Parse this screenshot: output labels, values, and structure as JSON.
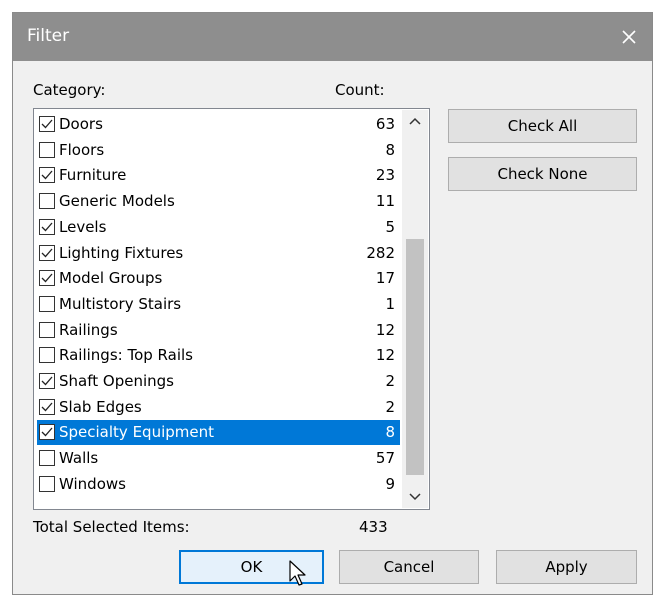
{
  "window": {
    "title": "Filter"
  },
  "headers": {
    "category": "Category:",
    "count": "Count:"
  },
  "items": [
    {
      "name": "Doors",
      "count": "63",
      "checked": true
    },
    {
      "name": "Floors",
      "count": "8",
      "checked": false
    },
    {
      "name": "Furniture",
      "count": "23",
      "checked": true
    },
    {
      "name": "Generic Models",
      "count": "11",
      "checked": false
    },
    {
      "name": "Levels",
      "count": "5",
      "checked": true
    },
    {
      "name": "Lighting Fixtures",
      "count": "282",
      "checked": true
    },
    {
      "name": "Model Groups",
      "count": "17",
      "checked": true
    },
    {
      "name": "Multistory Stairs",
      "count": "1",
      "checked": false
    },
    {
      "name": "Railings",
      "count": "12",
      "checked": false
    },
    {
      "name": "Railings: Top Rails",
      "count": "12",
      "checked": false
    },
    {
      "name": "Shaft Openings",
      "count": "2",
      "checked": true
    },
    {
      "name": "Slab Edges",
      "count": "2",
      "checked": true
    },
    {
      "name": "Specialty Equipment",
      "count": "8",
      "checked": true,
      "selected": true
    },
    {
      "name": "Walls",
      "count": "57",
      "checked": false
    },
    {
      "name": "Windows",
      "count": "9",
      "checked": false
    }
  ],
  "buttons": {
    "check_all": "Check All",
    "check_none": "Check None",
    "ok": "OK",
    "cancel": "Cancel",
    "apply": "Apply"
  },
  "total": {
    "label": "Total Selected Items:",
    "value": "433"
  },
  "colors": {
    "titlebar": "#8e8e8e",
    "selection": "#0078d7",
    "dialog_bg": "#f0f0f0"
  }
}
